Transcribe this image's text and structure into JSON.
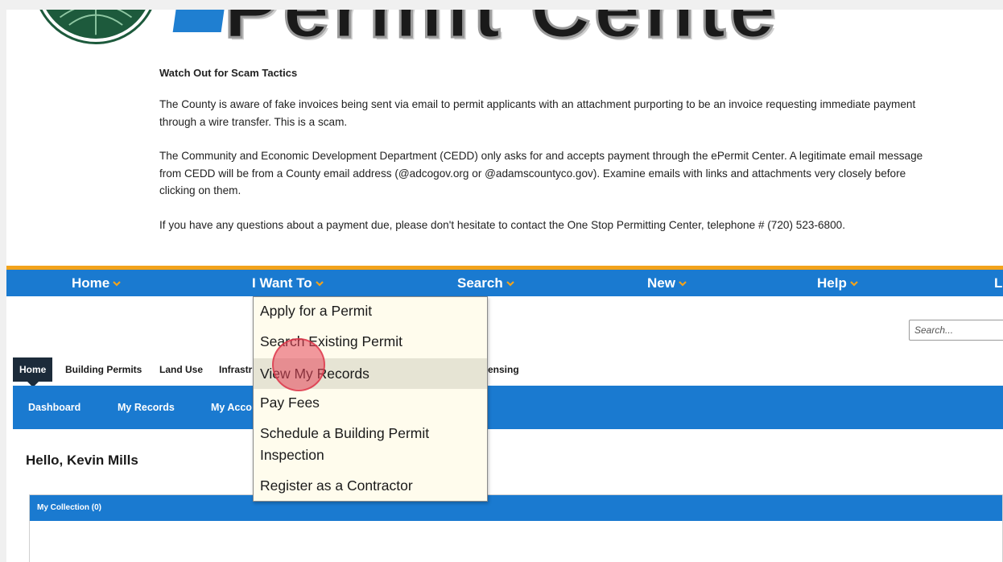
{
  "notice": {
    "title": "Watch Out for Scam Tactics",
    "p1": "The County is aware of fake invoices being sent via email to permit applicants with an attachment purporting to be an invoice requesting immediate payment through a wire transfer. This is a scam.",
    "p2": "The Community and Economic Development Department (CEDD) only asks for and accepts payment through the ePermit Center. A legitimate email message from CEDD will be from a County email address (@adcogov.org or @adamscountyco.gov). Examine emails with links and attachments very closely before clicking on them.",
    "p3": "If you have any questions about a payment due, please don't hesitate to contact the One Stop Permitting Center, telephone # (720) 523-6800."
  },
  "banner": {
    "partial_heading": "Permit Cente"
  },
  "menu": {
    "home": "Home",
    "i_want_to": "I Want To",
    "search": "Search",
    "new": "New",
    "help": "Help",
    "cut_item": "L"
  },
  "dropdown": {
    "items": [
      "Apply for a Permit",
      "Search Existing Permit",
      "View My Records",
      "Pay Fees",
      "Schedule a Building Permit",
      "Inspection",
      "Register as a Contractor"
    ]
  },
  "search": {
    "placeholder": "Search..."
  },
  "module_tabs": {
    "home": "Home",
    "building_permits": "Building Permits",
    "land_use": "Land Use",
    "infrastructure_partial": "Infrastr",
    "licensing_partial": "ensing"
  },
  "subnav": {
    "dashboard": "Dashboard",
    "my_records": "My Records",
    "my_account_partial": "My Acco"
  },
  "greeting": "Hello, Kevin Mills",
  "collection": {
    "header": "My Collection (0)"
  },
  "colors": {
    "menu_blue": "#1a7ad0",
    "accent_orange": "#f2a31b",
    "dropdown_bg": "#fffced",
    "tab_dark": "#1c2b3a"
  }
}
